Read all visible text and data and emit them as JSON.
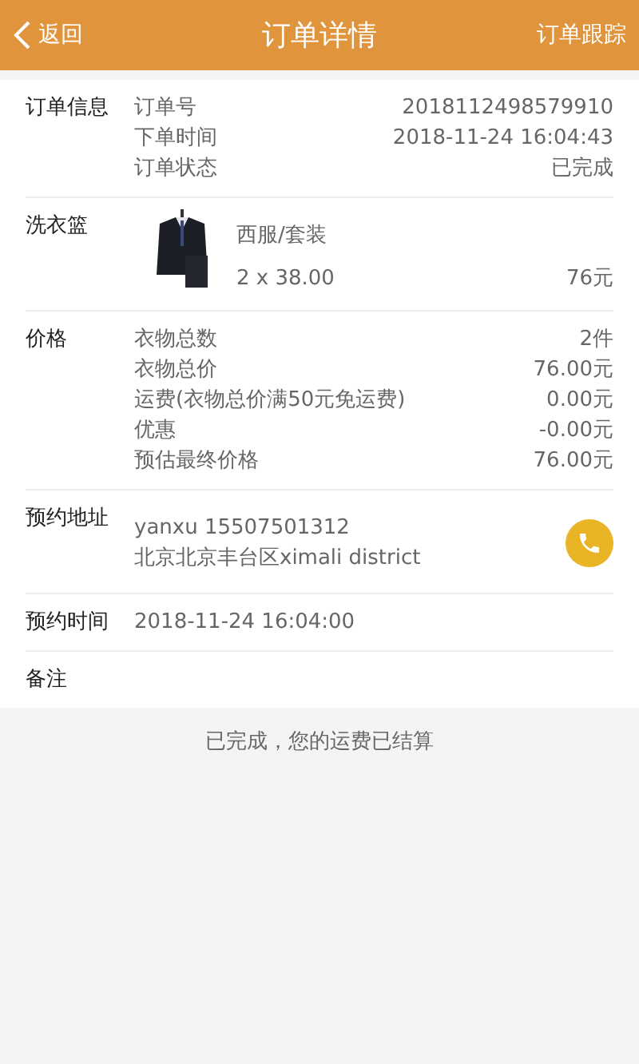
{
  "header": {
    "back": "返回",
    "title": "订单详情",
    "action": "订单跟踪"
  },
  "sections": [
    {
      "kind": "rows",
      "label": "订单信息",
      "rows": [
        {
          "name": "订单号",
          "value": "2018112498579910"
        },
        {
          "name": "下单时间",
          "value": "2018-11-24 16:04:43"
        },
        {
          "name": "订单状态",
          "value": "已完成"
        }
      ]
    },
    {
      "kind": "basket",
      "label": "洗衣篮",
      "items": [
        {
          "kind": "picture",
          "name": "西服/套装",
          "quantity": "2 x 38.00",
          "total": "76元"
        }
      ]
    },
    {
      "kind": "rows",
      "label": "价格",
      "rows": [
        {
          "name": "衣物总数",
          "value": "2件"
        },
        {
          "name": "衣物总价",
          "value": "76.00元"
        },
        {
          "name": "运费(衣物总价满50元免运费)",
          "value": "0.00元"
        },
        {
          "name": "优惠",
          "value": "-0.00元"
        },
        {
          "name": "预估最终价格",
          "value": "76.00元"
        }
      ]
    },
    {
      "kind": "address",
      "label": "预约地址",
      "lines": [
        "yanxu 15507501312",
        "北京北京丰台区ximali district"
      ]
    },
    {
      "kind": "text",
      "label": "预约时间",
      "text": "2018-11-24 16:04:00"
    },
    {
      "kind": "text",
      "label": "备注"
    }
  ],
  "footer": "已完成，您的运费已结算"
}
